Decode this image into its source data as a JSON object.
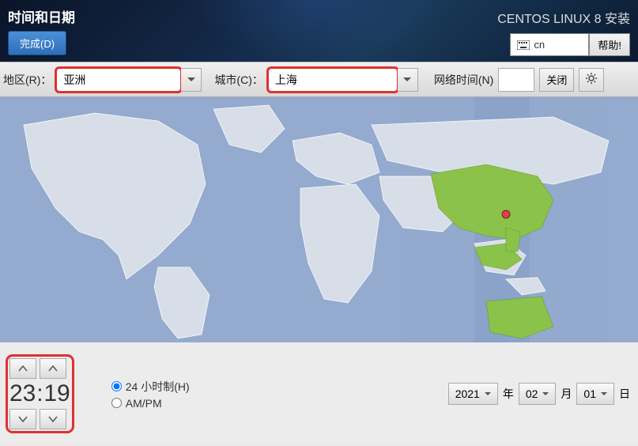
{
  "header": {
    "title": "时间和日期",
    "done_label": "完成(D)",
    "install_label": "CENTOS LINUX 8 安装",
    "keyboard_layout": "cn",
    "help_label": "帮助!"
  },
  "toolbar": {
    "region_label": "地区(R)：",
    "region_value": "亚洲",
    "city_label": "城市(C)：",
    "city_value": "上海",
    "network_time_label": "网络时间(N)",
    "network_time_switch": "关闭"
  },
  "time": {
    "hours": "23",
    "minutes": "19",
    "separator": ":"
  },
  "format": {
    "h24_label": "24 小时制(H)",
    "ampm_label": "AM/PM",
    "selected": "24h"
  },
  "date": {
    "year": "2021",
    "year_suffix": "年",
    "month": "02",
    "month_suffix": "月",
    "day": "01",
    "day_suffix": "日"
  }
}
